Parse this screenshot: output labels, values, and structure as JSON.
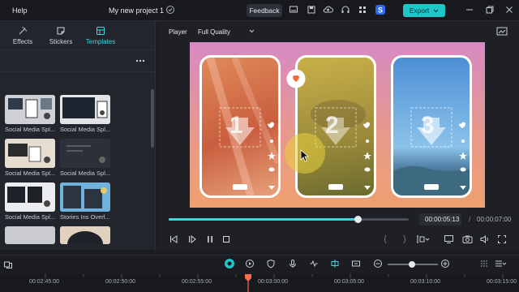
{
  "titlebar": {
    "menu_help": "Help",
    "project_title": "My new project 1",
    "feedback_label": "Feedback",
    "export_label": "Export"
  },
  "left_panel": {
    "tabs": [
      {
        "label": "Effects",
        "icon": "effects-icon"
      },
      {
        "label": "Stickers",
        "icon": "stickers-icon"
      },
      {
        "label": "Templates",
        "icon": "templates-icon",
        "active": true
      }
    ],
    "templates": [
      {
        "label": "Social Media Spl..."
      },
      {
        "label": "Social Media Spl..."
      },
      {
        "label": "Social Media Spl..."
      },
      {
        "label": "Social Media Spl..."
      },
      {
        "label": "Social Media Spl..."
      },
      {
        "label": "Stories Ins Overl..."
      }
    ]
  },
  "player": {
    "label": "Player",
    "quality": "Full Quality",
    "current_time": "00:00:05:13",
    "separator": "/",
    "total_time": "00:00:07:00",
    "progress": 0.79,
    "phones": [
      {
        "number": "1"
      },
      {
        "number": "2"
      },
      {
        "number": "3"
      }
    ]
  },
  "timeline": {
    "ticks": [
      "00:02:45:00",
      "00:02:50:00",
      "00:02:55:00",
      "00:03:00:00",
      "00:03:05:00",
      "00:03:10:00",
      "00:03:15:00"
    ]
  },
  "colors": {
    "accent": "#1fc7c9",
    "playhead": "#ff6b4a",
    "background": "#1b1d22"
  }
}
